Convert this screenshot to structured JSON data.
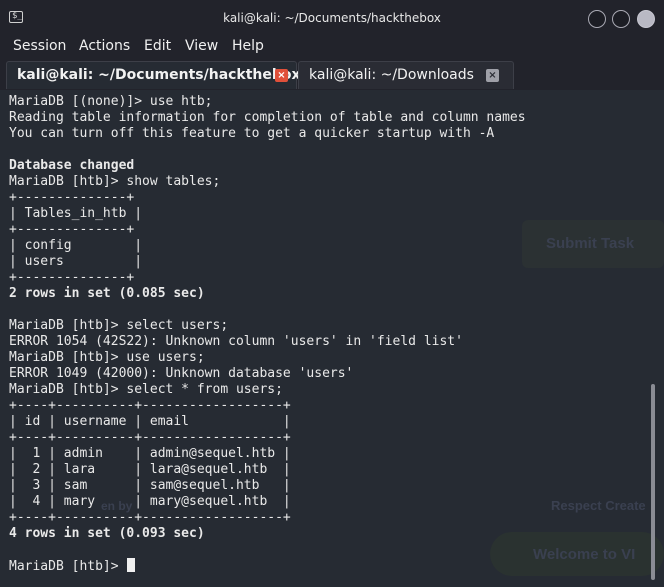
{
  "window": {
    "title": "kali@kali: ~/Documents/hackthebox",
    "term_icon_glyph": "$_"
  },
  "menu": [
    "Session",
    "Actions",
    "Edit",
    "View",
    "Help"
  ],
  "tabs": [
    {
      "label": "kali@kali: ~/Documents/hackthebox",
      "active": true
    },
    {
      "label": "kali@kali: ~/Downloads",
      "active": false
    }
  ],
  "tab_close_glyph": "×",
  "background_page": {
    "button": "Submit Task",
    "text1": "Respect Create",
    "text2": "Welcome to VI",
    "text3": "en by"
  },
  "terminal": {
    "lines": [
      {
        "text": "MariaDB [(none)]> use htb;",
        "bold": false
      },
      {
        "text": "Reading table information for completion of table and column names",
        "bold": false
      },
      {
        "text": "You can turn off this feature to get a quicker startup with -A",
        "bold": false
      },
      {
        "text": "",
        "bold": false
      },
      {
        "text": "Database changed",
        "bold": true
      },
      {
        "text": "MariaDB [htb]> show tables;",
        "bold": false
      },
      {
        "text": "+--------------+",
        "bold": false
      },
      {
        "text": "| Tables_in_htb |",
        "bold": false
      },
      {
        "text": "+--------------+",
        "bold": false
      },
      {
        "text": "| config        |",
        "bold": false
      },
      {
        "text": "| users         |",
        "bold": false
      },
      {
        "text": "+--------------+",
        "bold": false
      },
      {
        "text": "2 rows in set (0.085 sec)",
        "bold": true
      },
      {
        "text": "",
        "bold": false
      },
      {
        "text": "MariaDB [htb]> select users;",
        "bold": false
      },
      {
        "text": "ERROR 1054 (42S22): Unknown column 'users' in 'field list'",
        "bold": false
      },
      {
        "text": "MariaDB [htb]> use users;",
        "bold": false
      },
      {
        "text": "ERROR 1049 (42000): Unknown database 'users'",
        "bold": false
      },
      {
        "text": "MariaDB [htb]> select * from users;",
        "bold": false
      },
      {
        "text": "+----+----------+------------------+",
        "bold": false
      },
      {
        "text": "| id | username | email            |",
        "bold": false
      },
      {
        "text": "+----+----------+------------------+",
        "bold": false
      },
      {
        "text": "|  1 | admin    | admin@sequel.htb |",
        "bold": false
      },
      {
        "text": "|  2 | lara     | lara@sequel.htb  |",
        "bold": false
      },
      {
        "text": "|  3 | sam      | sam@sequel.htb   |",
        "bold": false
      },
      {
        "text": "|  4 | mary     | mary@sequel.htb  |",
        "bold": false
      },
      {
        "text": "+----+----------+------------------+",
        "bold": false
      },
      {
        "text": "4 rows in set (0.093 sec)",
        "bold": true
      },
      {
        "text": "",
        "bold": false
      },
      {
        "text": "MariaDB [htb]> ",
        "bold": false,
        "cursor": true
      }
    ]
  }
}
